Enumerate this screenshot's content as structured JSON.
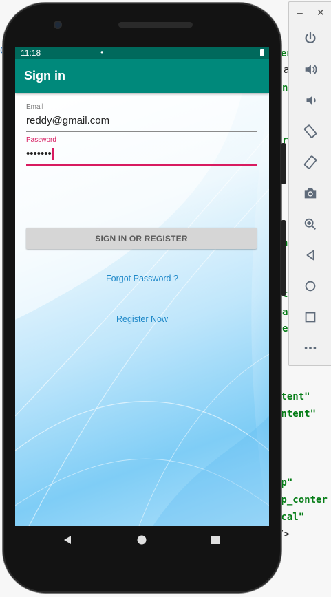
{
  "ide_background": {
    "fragments": [
      "en",
      "a",
      "n",
      "r",
      "n",
      "t",
      "at",
      "e",
      "ntent\"",
      "ontent\"",
      "dp\"",
      "ap_conter",
      "ical\"",
      "/>",
      "G"
    ]
  },
  "toolbar": {
    "minimize_label": "–",
    "close_label": "✕",
    "buttons": [
      "power-icon",
      "volume-up-icon",
      "volume-down-icon",
      "rotate-left-icon",
      "rotate-right-icon",
      "camera-icon",
      "zoom-icon",
      "back-icon",
      "home-icon",
      "overview-icon",
      "more-icon"
    ]
  },
  "status_bar": {
    "time": "11:18",
    "dot": "•"
  },
  "app_bar": {
    "title": "Sign in"
  },
  "form": {
    "email_label": "Email",
    "email_value": "reddy@gmail.com",
    "password_label": "Password",
    "password_value": "•••••••",
    "signin_label": "SIGN IN OR REGISTER",
    "forgot_label": "Forgot Password ?",
    "register_label": "Register Now"
  },
  "colors": {
    "status_bar": "#00695c",
    "app_bar": "#00897b",
    "accent": "#d81b60",
    "link": "#1e88c8",
    "button": "#d6d6d6"
  }
}
